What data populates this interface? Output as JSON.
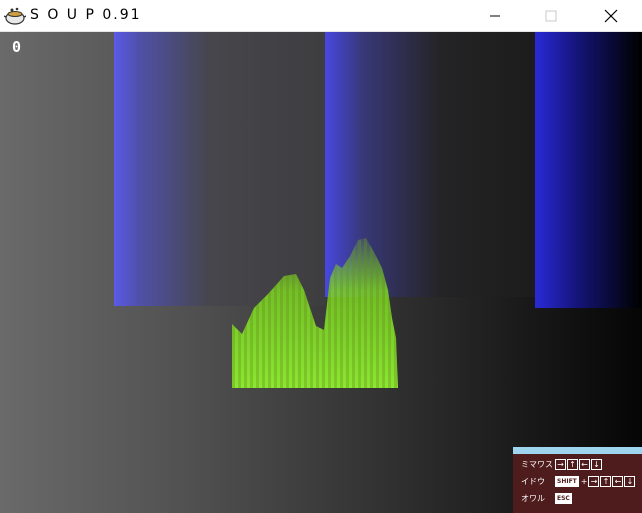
{
  "window": {
    "title": "S O U P 0.91",
    "icon": "soup-pot-icon",
    "minimize_icon": "minimize-icon",
    "maximize_icon": "maximize-icon",
    "close_icon": "close-icon"
  },
  "hud": {
    "score": "0"
  },
  "colors": {
    "wall_blue": "#4848e0",
    "fire_green": "#7fe020",
    "panel_bg": "#4e1c1c",
    "panel_top": "#9ed4ee"
  },
  "controls": {
    "rows": [
      {
        "label": "ミマワス",
        "keys": [
          "→",
          "↑",
          "←",
          "↓"
        ],
        "modifier": ""
      },
      {
        "label": "イドウ",
        "keys": [
          "→",
          "↑",
          "←",
          "↓"
        ],
        "modifier": "SHIFT"
      },
      {
        "label": "オワル",
        "keys": [],
        "modifier": "ESC"
      }
    ]
  }
}
